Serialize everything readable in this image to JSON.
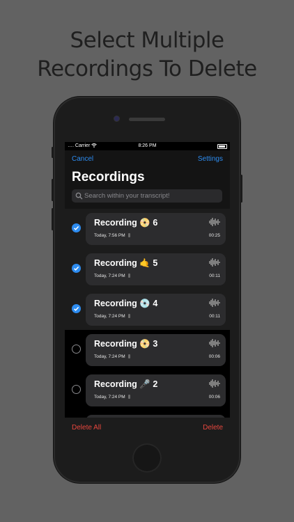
{
  "headline": {
    "line1": "Select Multiple",
    "line2": "Recordings To Delete"
  },
  "status_bar": {
    "carrier": "…. Carrier",
    "time": "8:26 PM"
  },
  "nav": {
    "cancel": "Cancel",
    "settings": "Settings",
    "title": "Recordings"
  },
  "search": {
    "placeholder": "Search within your transcript!"
  },
  "recordings": [
    {
      "name": "Recording 📀 6",
      "meta": "Today, 7:56 PM",
      "duration": "00:25",
      "selected": true
    },
    {
      "name": "Recording 🤙 5",
      "meta": "Today, 7:24 PM",
      "duration": "00:11",
      "selected": true
    },
    {
      "name": "Recording 💿 4",
      "meta": "Today, 7:24 PM",
      "duration": "00:11",
      "selected": true
    },
    {
      "name": "Recording 📀 3",
      "meta": "Today, 7:24 PM",
      "duration": "00:06",
      "selected": false
    },
    {
      "name": "Recording 🎤 2",
      "meta": "Today, 7:24 PM",
      "duration": "00:06",
      "selected": false
    }
  ],
  "bottom": {
    "delete_all": "Delete All",
    "delete": "Delete"
  },
  "colors": {
    "accent": "#2d8cf0",
    "destructive": "#e8473e",
    "card": "#2c2c2e"
  },
  "icons": {
    "search": "search-icon",
    "wave": "waveform-icon",
    "check": "checkmark-icon",
    "doc": "transcript-icon"
  }
}
